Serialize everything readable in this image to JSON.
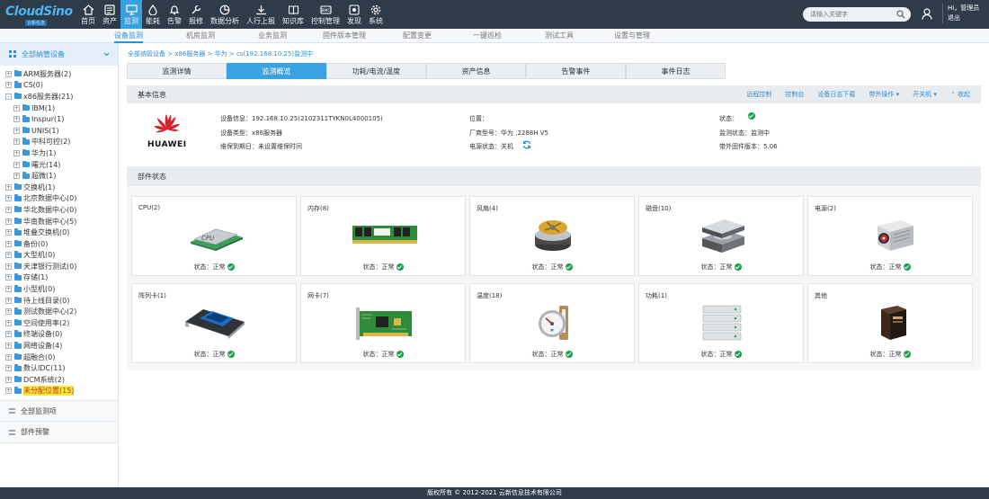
{
  "brand": {
    "name": "CloudSino",
    "sub": "云新信息"
  },
  "nav": [
    {
      "label": "首页",
      "icon": "home-icon"
    },
    {
      "label": "资产",
      "icon": "asset-icon"
    },
    {
      "label": "监测",
      "icon": "monitor-icon",
      "active": true
    },
    {
      "label": "能耗",
      "icon": "energy-icon"
    },
    {
      "label": "告警",
      "icon": "bell-icon"
    },
    {
      "label": "报修",
      "icon": "wrench-icon"
    },
    {
      "label": "数据分析",
      "icon": "chart-icon"
    },
    {
      "label": "人行上报",
      "icon": "report-icon"
    },
    {
      "label": "知识库",
      "icon": "book-icon"
    },
    {
      "label": "控制管理",
      "icon": "control-icon"
    },
    {
      "label": "发现",
      "icon": "discover-icon"
    },
    {
      "label": "系统",
      "icon": "gear-icon"
    }
  ],
  "search": {
    "placeholder": "请输入关键字"
  },
  "user": {
    "greeting": "Hi，管理员",
    "logout": "退出"
  },
  "subnav": [
    "设备监测",
    "机房监测",
    "业务监测",
    "固件版本管理",
    "配置变更",
    "一键巡检",
    "测试工具",
    "设置与管理"
  ],
  "sidebar": {
    "title": "全部纳管设备",
    "tree": [
      {
        "label": "ARM服务器(2)",
        "level": 0,
        "pm": "+"
      },
      {
        "label": "CS(0)",
        "level": 0,
        "pm": "+"
      },
      {
        "label": "x86服务器(21)",
        "level": 0,
        "pm": "-"
      },
      {
        "label": "IBM(1)",
        "level": 1,
        "pm": "+"
      },
      {
        "label": "Inspur(1)",
        "level": 1,
        "pm": "+"
      },
      {
        "label": "UNIS(1)",
        "level": 1,
        "pm": "+"
      },
      {
        "label": "中科可控(2)",
        "level": 1,
        "pm": "+"
      },
      {
        "label": "华为(1)",
        "level": 1,
        "pm": "+"
      },
      {
        "label": "曙光(14)",
        "level": 1,
        "pm": "+"
      },
      {
        "label": "超微(1)",
        "level": 1,
        "pm": "+"
      },
      {
        "label": "交换机(1)",
        "level": 0,
        "pm": "+"
      },
      {
        "label": "北京数据中心(0)",
        "level": 0,
        "pm": "+"
      },
      {
        "label": "华北数据中心(0)",
        "level": 0,
        "pm": "+"
      },
      {
        "label": "华南数据中心(5)",
        "level": 0,
        "pm": "+"
      },
      {
        "label": "堆叠交换机(0)",
        "level": 0,
        "pm": "+"
      },
      {
        "label": "备份(0)",
        "level": 0,
        "pm": "+"
      },
      {
        "label": "大型机(0)",
        "level": 0,
        "pm": "+"
      },
      {
        "label": "天津银行测试(0)",
        "level": 0,
        "pm": "+"
      },
      {
        "label": "存储(1)",
        "level": 0,
        "pm": "+"
      },
      {
        "label": "小型机(0)",
        "level": 0,
        "pm": "+"
      },
      {
        "label": "待上线目录(0)",
        "level": 0,
        "pm": "+"
      },
      {
        "label": "测试数据中心(2)",
        "level": 0,
        "pm": "+"
      },
      {
        "label": "空间使用率(2)",
        "level": 0,
        "pm": "+"
      },
      {
        "label": "终端设备(0)",
        "level": 0,
        "pm": "+"
      },
      {
        "label": "网络设备(4)",
        "level": 0,
        "pm": "+"
      },
      {
        "label": "超融合(0)",
        "level": 0,
        "pm": "+"
      },
      {
        "label": "数认IDC(11)",
        "level": 0,
        "pm": "+"
      },
      {
        "label": "DCM系统(2)",
        "level": 0,
        "pm": "+"
      },
      {
        "label": "未分配位置(15)",
        "level": 0,
        "pm": "+",
        "highlight": true
      }
    ],
    "bottom": [
      "全部监测项",
      "部件预警"
    ]
  },
  "breadcrumb": "全部纳管设备 > x86服务器 > 华为 > cs(192.168.10.25)监测中",
  "tabs": [
    "监测详情",
    "监测概览",
    "功耗/电流/温度",
    "资产信息",
    "告警事件",
    "事件日志"
  ],
  "basic": {
    "title": "基本信息",
    "actions": [
      "远程控制",
      "控制台",
      "设备日志下载",
      "带外操作 ▾",
      "开关机 ▾",
      "⌃ 收起"
    ],
    "logo_text": "HUAWEI",
    "device_info": "设备信息：192.168.10.25(2102311TYKN0L4000105)",
    "device_type": "设备类型：x86服务器",
    "warranty": "维保到期日：未设置维保时间",
    "location": "位置：",
    "model": "厂商型号：华为 ,2288H V5",
    "power": "电源状态：关机",
    "status": "状态：",
    "monitor_status": "监测状态：监测中",
    "firmware": "带外固件版本：5.06"
  },
  "components": {
    "title": "部件状态",
    "status_text": "状态：正常",
    "items": [
      {
        "label": "CPU(2)",
        "icon": "cpu-icon"
      },
      {
        "label": "内存(8)",
        "icon": "memory-icon"
      },
      {
        "label": "风扇(4)",
        "icon": "fan-icon"
      },
      {
        "label": "磁盘(10)",
        "icon": "disk-icon"
      },
      {
        "label": "电源(2)",
        "icon": "power-supply-icon"
      },
      {
        "label": "阵列卡(1)",
        "icon": "raid-card-icon"
      },
      {
        "label": "网卡(7)",
        "icon": "nic-icon"
      },
      {
        "label": "温度(18)",
        "icon": "thermometer-icon"
      },
      {
        "label": "功耗(1)",
        "icon": "power-icon"
      },
      {
        "label": "其他",
        "icon": "other-icon"
      }
    ]
  },
  "footer": "版权所有 © 2012-2021 云新信息技术有限公司"
}
